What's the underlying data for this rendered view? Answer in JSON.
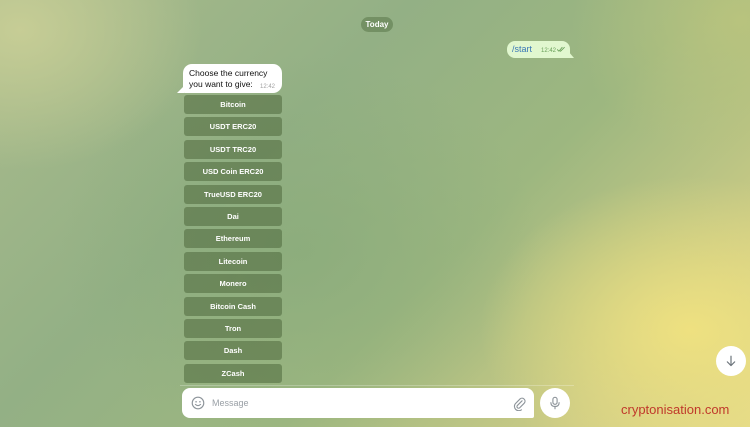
{
  "chat": {
    "date_label": "Today",
    "outgoing": {
      "text": "/start",
      "time": "12:42",
      "status_icon": "double-check-icon"
    },
    "incoming": {
      "text": "Choose the currency you want to give:",
      "time": "12:42"
    }
  },
  "keyboard": {
    "buttons": [
      "Bitcoin",
      "USDT ERC20",
      "USDT TRC20",
      "USD Coin ERC20",
      "TrueUSD ERC20",
      "Dai",
      "Ethereum",
      "Litecoin",
      "Monero",
      "Bitcoin Cash",
      "Tron",
      "Dash",
      "ZCash"
    ]
  },
  "composer": {
    "placeholder": "Message",
    "icons": {
      "emoji": "emoji-icon",
      "attach": "paperclip-icon",
      "voice": "microphone-icon",
      "scroll": "chevron-down-icon"
    }
  },
  "watermark": "cryptonisation.com",
  "colors": {
    "outgoing_bubble": "#e1f7cf",
    "incoming_bubble": "#ffffff",
    "keyboard_button": "#4e683c",
    "watermark": "#c0392b"
  }
}
